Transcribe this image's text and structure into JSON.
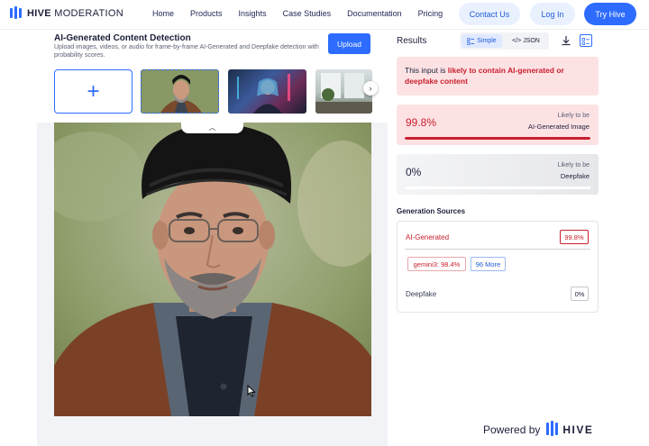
{
  "brand": {
    "name_bold": "HIVE",
    "name_rest": " MODERATION"
  },
  "nav": {
    "links": [
      "Home",
      "Products",
      "Insights",
      "Case Studies",
      "Documentation",
      "Pricing"
    ],
    "contact_label": "Contact Us",
    "login_label": "Log In",
    "try_label": "Try Hive"
  },
  "tool": {
    "title": "AI-Generated Content Detection",
    "subtitle": "Upload images, videos, or audio for frame-by-frame AI-Generated and Deepfake detection with probability scores.",
    "upload_label": "Upload",
    "add_symbol": "+"
  },
  "results": {
    "label": "Results",
    "view_simple": "Simple",
    "view_json": "</> JSON",
    "alert_prefix": "This input is ",
    "alert_highlight": "likely to contain AI-generated or deepfake content",
    "ai_card": {
      "percent": "99.8%",
      "likely": "Likely to be",
      "label": "AI-Generated Image",
      "fill": 0.998
    },
    "deepfake_card": {
      "percent": "0%",
      "likely": "Likely to be",
      "label": "Deepfake",
      "fill": 0.0
    }
  },
  "sources": {
    "title": "Generation Sources",
    "ai_label": "AI-Generated",
    "ai_badge": "99.8%",
    "model_chip": "gemini3: 98.4%",
    "more_chip": "96 More",
    "deepfake_label": "Deepfake",
    "deepfake_badge": "0%"
  },
  "footer": {
    "powered_by": "Powered by",
    "hive": "HIVE"
  },
  "colors": {
    "accent": "#2d6cff",
    "danger": "#c8202e",
    "alert_bg": "#fde2e4"
  }
}
